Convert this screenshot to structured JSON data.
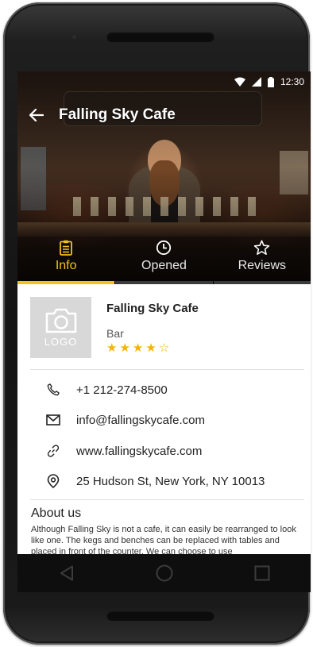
{
  "status_bar": {
    "time": "12:30"
  },
  "app_bar": {
    "title": "Falling Sky Cafe"
  },
  "tabs": [
    {
      "label": "Info",
      "icon": "clipboard-icon",
      "active": true
    },
    {
      "label": "Opened",
      "icon": "clock-icon",
      "active": false
    },
    {
      "label": "Reviews",
      "icon": "star-outline-icon",
      "active": false
    }
  ],
  "business": {
    "logo_text": "LOGO",
    "name": "Falling Sky Cafe",
    "category": "Bar",
    "rating": 4,
    "rating_max": 5,
    "star_full": "★",
    "star_empty": "☆"
  },
  "contact": {
    "phone": "+1 212-274-8500",
    "email": "info@fallingskycafe.com",
    "website": "www.fallingskycafe.com",
    "address": "25 Hudson St, New York, NY 10013"
  },
  "about": {
    "title": "About us",
    "text": "Although Falling Sky is not a cafe, it can easily be rearranged to look like one. The kegs and benches can be replaced with tables and placed in front of the counter. We can choose to use"
  },
  "colors": {
    "accent": "#f4c11a",
    "star": "#f4b400",
    "nav_bar": "#0e0e0e"
  }
}
